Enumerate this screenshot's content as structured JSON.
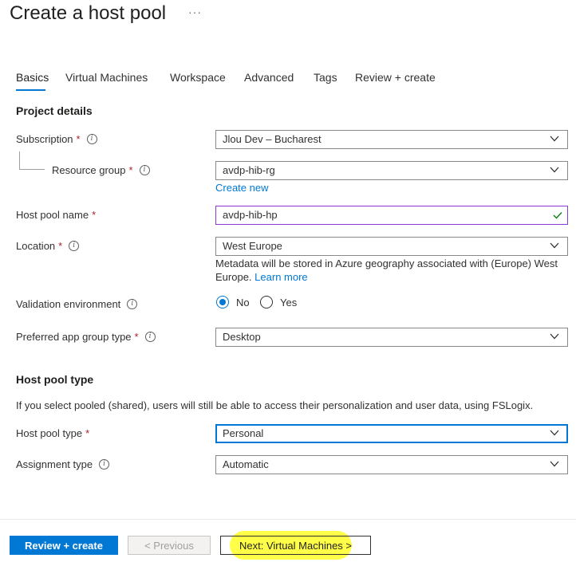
{
  "header": {
    "title": "Create a host pool",
    "more": "···"
  },
  "tabs": [
    {
      "label": "Basics",
      "active": true
    },
    {
      "label": "Virtual Machines",
      "active": false
    },
    {
      "label": "Workspace",
      "active": false
    },
    {
      "label": "Advanced",
      "active": false
    },
    {
      "label": "Tags",
      "active": false
    },
    {
      "label": "Review + create",
      "active": false
    }
  ],
  "project": {
    "title": "Project details",
    "subscription": {
      "label": "Subscription",
      "value": "Jlou Dev – Bucharest"
    },
    "resource_group": {
      "label": "Resource group",
      "value": "avdp-hib-rg",
      "create_new": "Create new"
    },
    "host_pool_name": {
      "label": "Host pool name",
      "value": "avdp-hib-hp"
    },
    "location": {
      "label": "Location",
      "value": "West Europe",
      "hint": "Metadata will be stored in Azure geography associated with (Europe) West Europe.",
      "learn_more": "Learn more"
    },
    "validation": {
      "label": "Validation environment",
      "options": [
        "No",
        "Yes"
      ],
      "selected": "No"
    },
    "app_group": {
      "label": "Preferred app group type",
      "value": "Desktop"
    }
  },
  "host_pool_type": {
    "title": "Host pool type",
    "description": "If you select pooled (shared), users will still be able to access their personalization and user data, using FSLogix.",
    "type": {
      "label": "Host pool type",
      "value": "Personal"
    },
    "assignment": {
      "label": "Assignment type",
      "value": "Automatic"
    }
  },
  "footer": {
    "review_create": "Review + create",
    "previous": "< Previous",
    "next": "Next: Virtual Machines >"
  },
  "required_marker": "*",
  "colors": {
    "accent": "#0078d4",
    "required": "#a4262c",
    "valid": "#107c10",
    "highlight": "#ffff33"
  }
}
